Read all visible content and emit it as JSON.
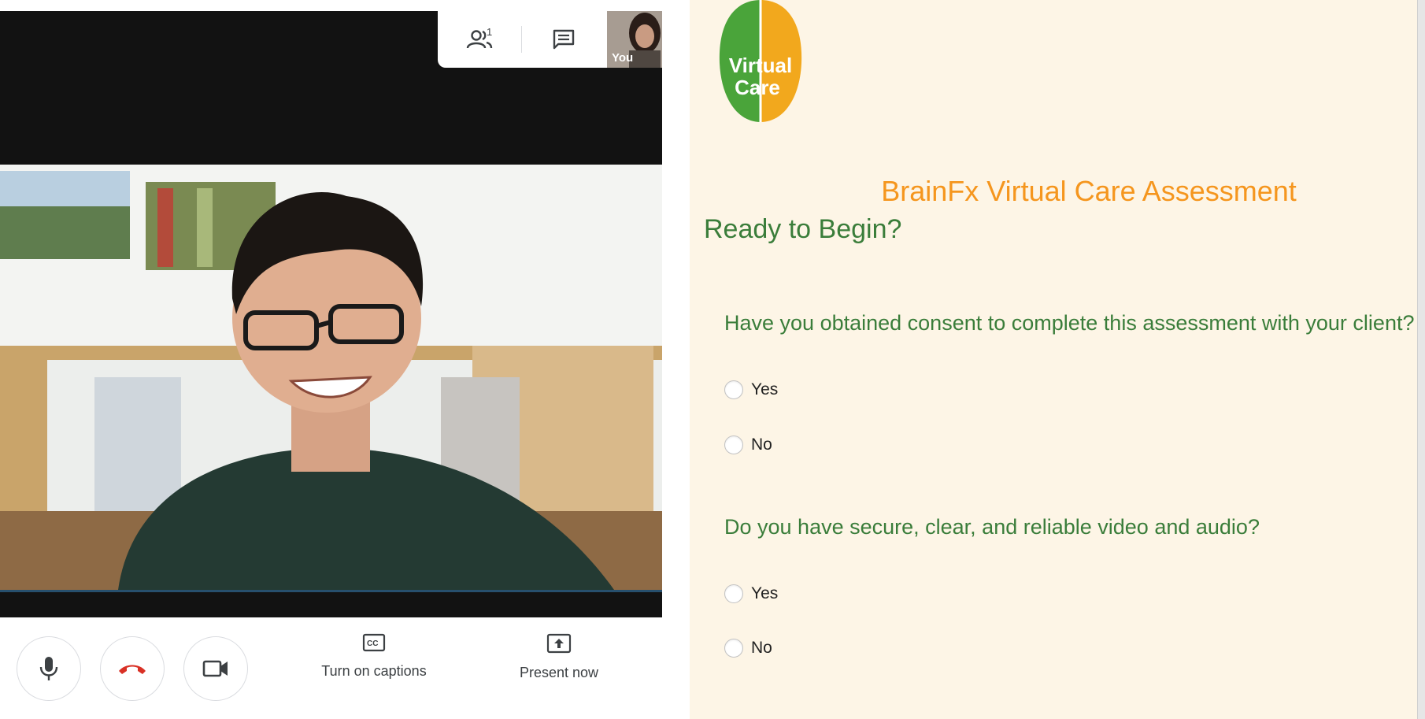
{
  "call": {
    "participants_count": "1",
    "self_label": "You",
    "controls": {
      "captions_label": "Turn on captions",
      "present_label": "Present now"
    }
  },
  "form": {
    "title": "BrainFx Virtual Care Assessment",
    "subtitle": "Ready to Begin?",
    "logo": {
      "line1": "Virtual",
      "line2": "Care"
    },
    "questions": [
      {
        "text": "Have you obtained consent to complete this assessment with your client?",
        "options": [
          "Yes",
          "No"
        ]
      },
      {
        "text": "Do you have secure, clear, and reliable video and audio?",
        "options": [
          "Yes",
          "No"
        ]
      }
    ]
  },
  "colors": {
    "title_orange": "#f5961e",
    "heading_green": "#3a7d3a",
    "form_background": "#fdf5e6",
    "hangup_red": "#d93025"
  }
}
